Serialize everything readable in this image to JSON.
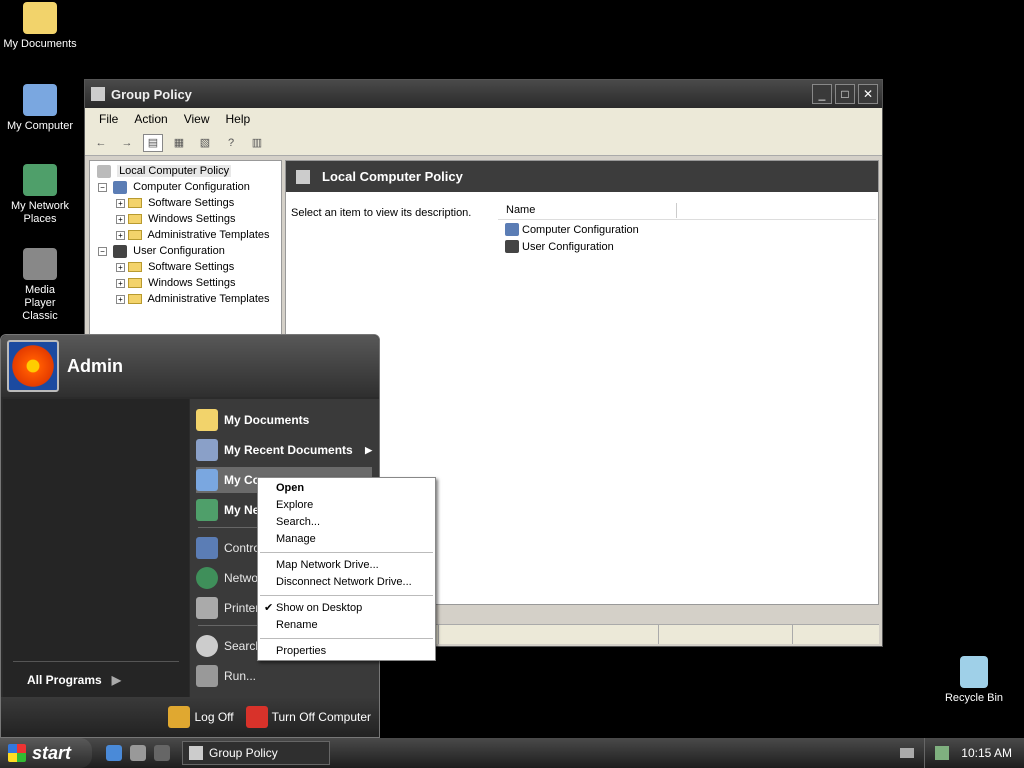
{
  "desktop": {
    "icons": [
      {
        "label": "My Documents",
        "color": "#f2d36b"
      },
      {
        "label": "My Computer",
        "color": "#7aa7e0"
      },
      {
        "label": "My Network Places",
        "color": "#4f9f6a"
      },
      {
        "label": "Media Player Classic",
        "color": "#888888"
      },
      {
        "label": "Recycle Bin",
        "color": "#9fd0e8"
      }
    ]
  },
  "window": {
    "title": "Group Policy",
    "menu": [
      "File",
      "Action",
      "View",
      "Help"
    ],
    "tree": {
      "root": "Local Computer Policy",
      "computer": "Computer Configuration",
      "user": "User Configuration",
      "children": [
        "Software Settings",
        "Windows Settings",
        "Administrative Templates"
      ]
    },
    "right": {
      "header": "Local Computer Policy",
      "description": "Select an item to view its description.",
      "column": "Name",
      "items": [
        "Computer Configuration",
        "User Configuration"
      ]
    }
  },
  "startmenu": {
    "user": "Admin",
    "items": [
      {
        "label": "My Documents",
        "color": "#f2d36b"
      },
      {
        "label": "My Recent Documents",
        "color": "#8aa0c8"
      },
      {
        "label": "My Co",
        "color": "#7aa7e0"
      },
      {
        "label": "My Ne",
        "color": "#4f9f6a"
      },
      {
        "label": "Contro",
        "color": "#5b7db5"
      },
      {
        "label": "Netwo",
        "color": "#3f8f5a"
      },
      {
        "label": "Printer",
        "color": "#aaaaaa"
      },
      {
        "label": "Search",
        "color": "#cccccc"
      },
      {
        "label": "Run...",
        "color": "#999999"
      }
    ],
    "all_programs": "All Programs",
    "log_off": "Log Off",
    "turn_off": "Turn Off Computer"
  },
  "context_menu": {
    "open": "Open",
    "explore": "Explore",
    "search": "Search...",
    "manage": "Manage",
    "map_drive": "Map Network Drive...",
    "disconnect_drive": "Disconnect Network Drive...",
    "show_desktop": "Show on Desktop",
    "rename": "Rename",
    "properties": "Properties"
  },
  "taskbar": {
    "start": "start",
    "task": "Group Policy",
    "clock": "10:15 AM"
  }
}
